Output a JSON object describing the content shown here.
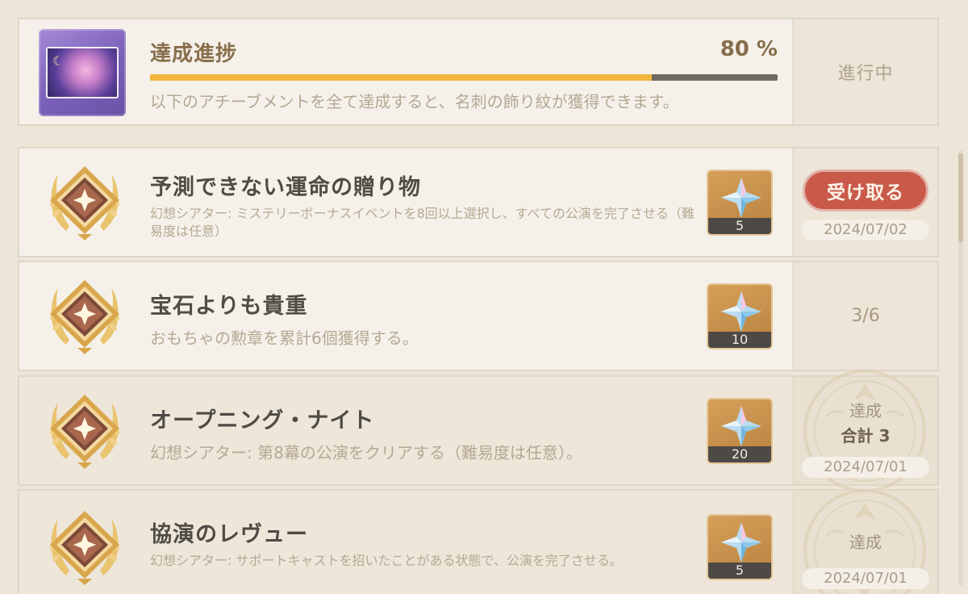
{
  "progress": {
    "title": "達成進捗",
    "percent_text": "80 %",
    "percent_value": 0.8,
    "description": "以下のアチーブメントを全て達成すると、名刺の飾り紋が獲得できます。",
    "status": "進行中"
  },
  "achievements": [
    {
      "title": "予測できない運命の贈り物",
      "description": "幻想シアター: ミステリーボーナスイベントを8回以上選択し、すべての公演を完了させる（難易度は任意）",
      "reward_count": "5",
      "action_label": "受け取る",
      "date": "2024/07/02"
    },
    {
      "title": "宝石よりも貴重",
      "description": "おもちゃの勲章を累計6個獲得する。",
      "reward_count": "10",
      "progress": "3/6"
    },
    {
      "title": "オープニング・ナイト",
      "description": "幻想シアター: 第8幕の公演をクリアする（難易度は任意）。",
      "reward_count": "20",
      "status": "達成",
      "total": "合計 3",
      "date": "2024/07/01"
    },
    {
      "title": "協演のレヴュー",
      "description": "幻想シアター: サポートキャストを招いたことがある状態で、公演を完了させる。",
      "reward_count": "5",
      "status": "達成",
      "date": "2024/07/01"
    }
  ],
  "colors": {
    "accent_gold": "#f0b73b",
    "claim_red": "#c95a4a",
    "title_brown": "#876e4b"
  },
  "icons": {
    "namecard": "namecard-thumbnail",
    "badge": "laurel-star-badge-icon",
    "reward": "primogem-icon",
    "seal": "completed-seal-icon"
  }
}
